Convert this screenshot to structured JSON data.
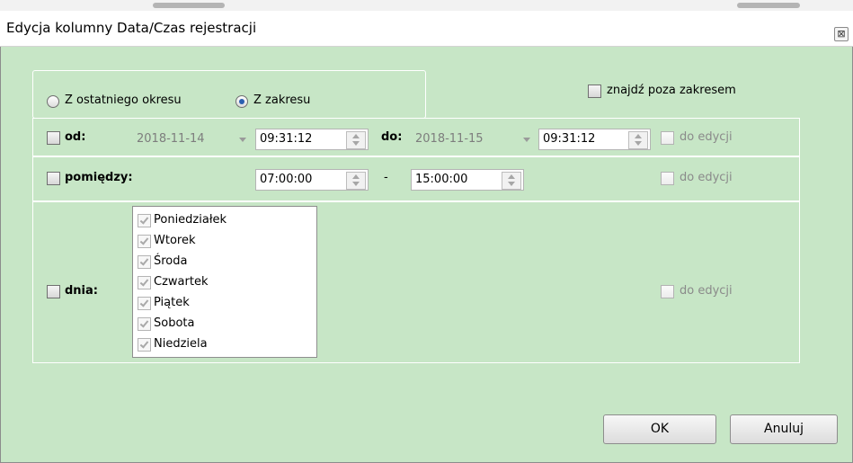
{
  "dialog": {
    "title": "Edycja kolumny Data/Czas rejestracji",
    "close_glyph": "⊠"
  },
  "mode": {
    "options": [
      {
        "label": "Z ostatniego okresu",
        "selected": false
      },
      {
        "label": "Z zakresu",
        "selected": true
      }
    ],
    "find_outside_label": "znajdź poza zakresem",
    "find_outside_checked": false
  },
  "range_from": {
    "checkbox_label": "od:",
    "checked": false,
    "from_date": "2018-11-14",
    "from_time": "09:31:12",
    "to_label": "do:",
    "to_date": "2018-11-15",
    "to_time": "09:31:12",
    "edit_label": "do edycji"
  },
  "between": {
    "checkbox_label": "pomiędzy:",
    "checked": false,
    "start_time": "07:00:00",
    "separator": "-",
    "end_time": "15:00:00",
    "edit_label": "do edycji"
  },
  "days": {
    "checkbox_label": "dnia:",
    "checked": false,
    "items": [
      {
        "label": "Poniedziałek",
        "checked": true
      },
      {
        "label": "Wtorek",
        "checked": true
      },
      {
        "label": "Środa",
        "checked": true
      },
      {
        "label": "Czwartek",
        "checked": true
      },
      {
        "label": "Piątek",
        "checked": true
      },
      {
        "label": "Sobota",
        "checked": true
      },
      {
        "label": "Niedziela",
        "checked": true
      }
    ],
    "edit_label": "do edycji"
  },
  "buttons": {
    "ok": "OK",
    "cancel": "Anuluj"
  },
  "colors": {
    "dialog_background": "#c7e6c6",
    "radio_selected": "#2a5fb0"
  }
}
